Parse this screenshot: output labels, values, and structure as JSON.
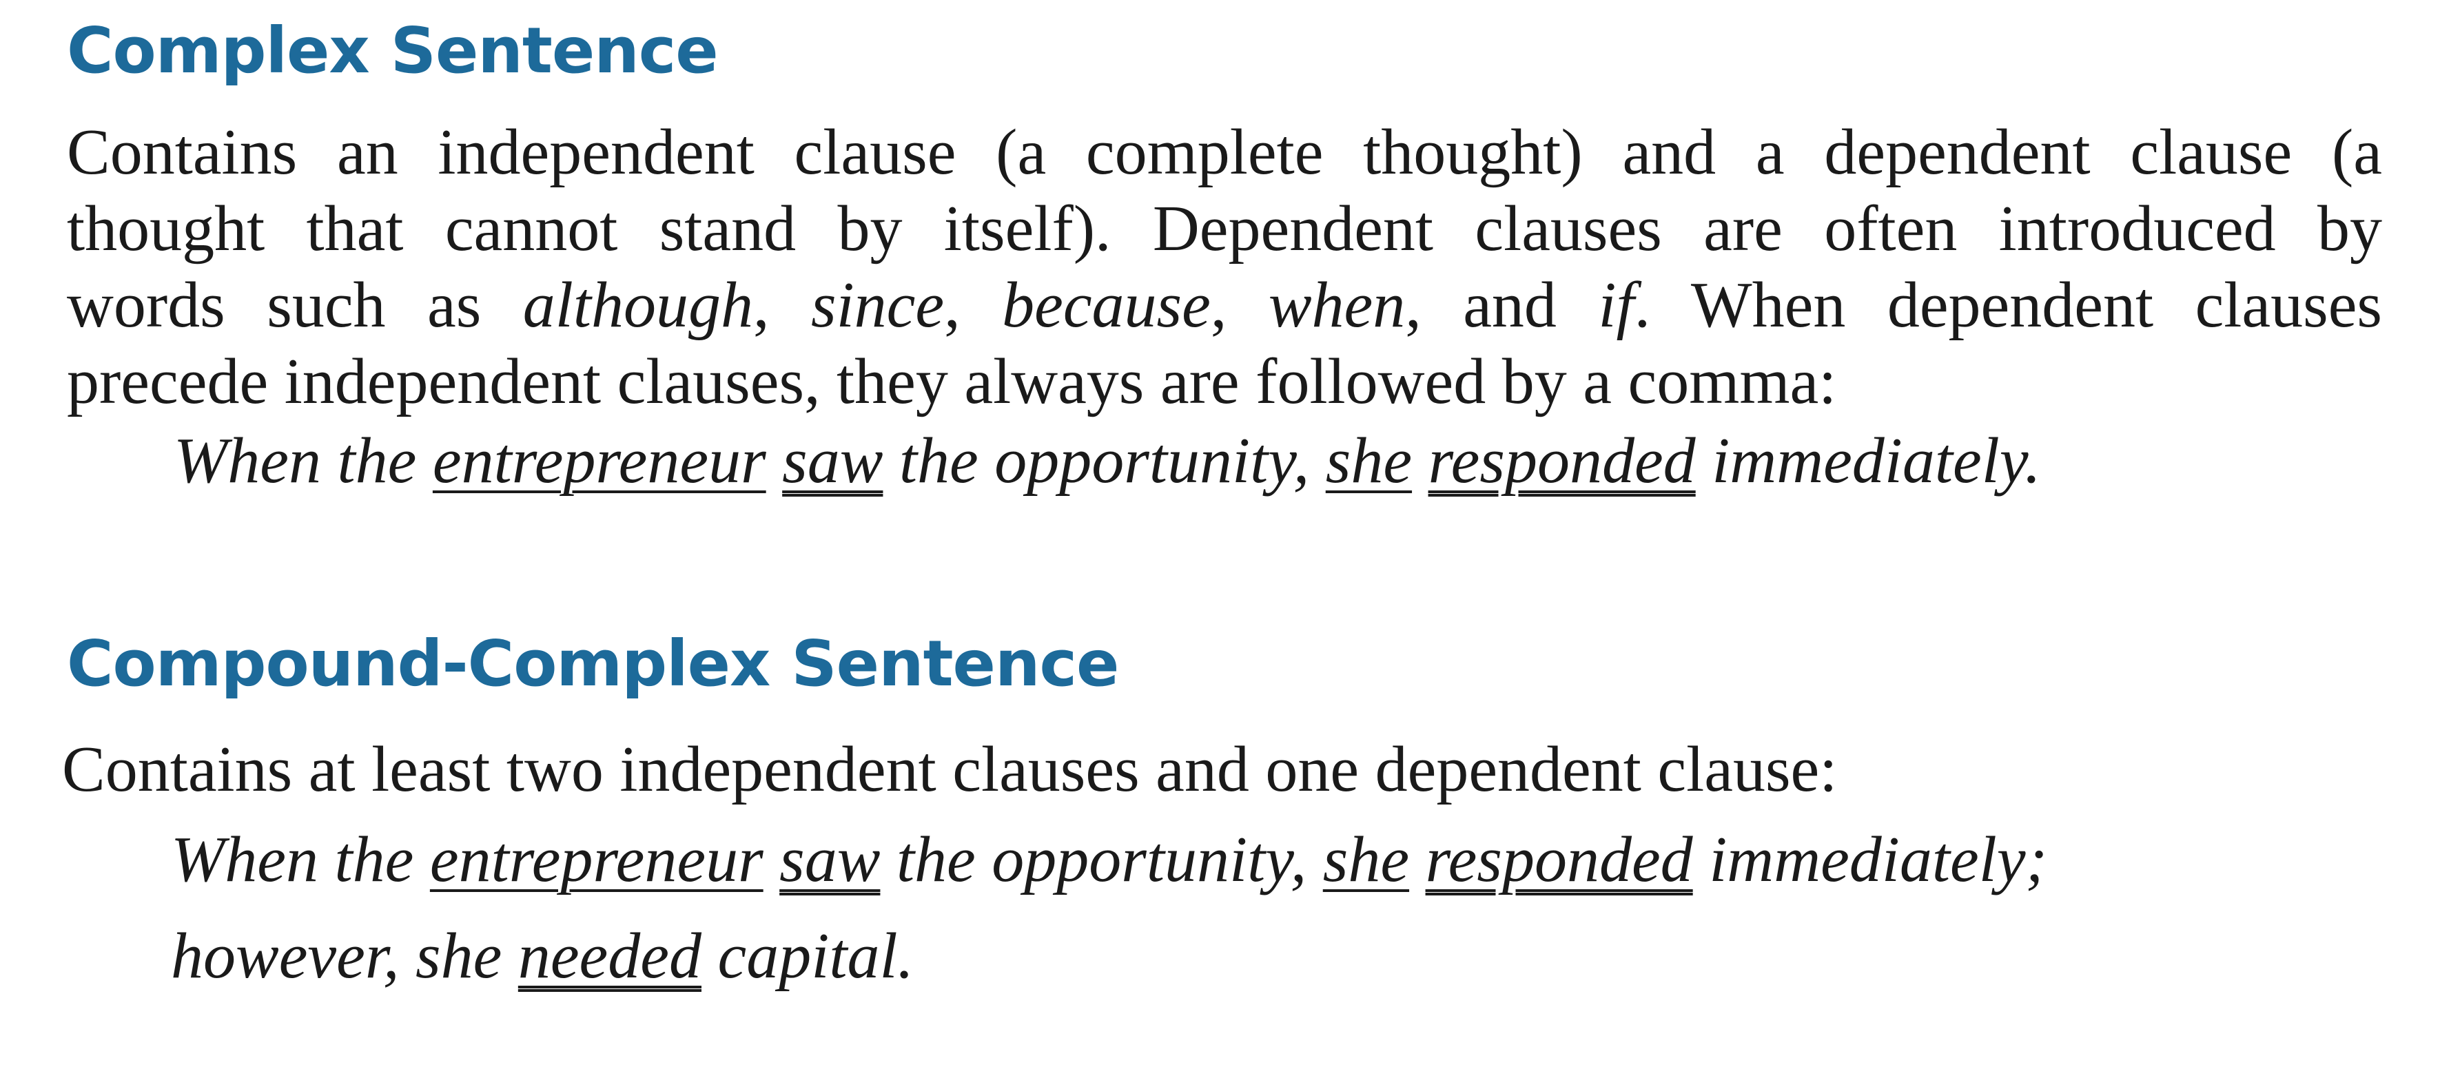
{
  "sections": [
    {
      "heading": "Complex Sentence",
      "description": {
        "line1": "Contains an independent clause (a complete thought) and a dependent clause (a",
        "line2": "thought that cannot stand by itself). Dependent clauses are often introduced by",
        "line3_start": "words such as ",
        "italic_words": [
          "although",
          "since",
          "because",
          "when",
          "if"
        ],
        "sep": ", ",
        "and": "and ",
        "line3_end": ". When dependent clauses",
        "line4": "precede independent clauses, they always are followed by a comma:"
      },
      "example": {
        "t1": "When the ",
        "subject1": "entrepreneur",
        "t2": " ",
        "verb1": "saw",
        "t3": " the opportunity, ",
        "subject2": "she",
        "t4": " ",
        "verb2": "responded",
        "t5": " immediately."
      }
    },
    {
      "heading": "Compound-Complex Sentence",
      "description": {
        "line1": "Contains at least two independent clauses and one dependent clause:"
      },
      "example": {
        "t1": "When the ",
        "subject1": "entrepreneur",
        "t2": " ",
        "verb1": "saw",
        "t3": " the opportunity, ",
        "subject2": "she",
        "t4": " ",
        "verb2": "responded",
        "t5": " immediately;",
        "t6": "however, she ",
        "verb3": "needed",
        "t7": " capital."
      }
    }
  ]
}
